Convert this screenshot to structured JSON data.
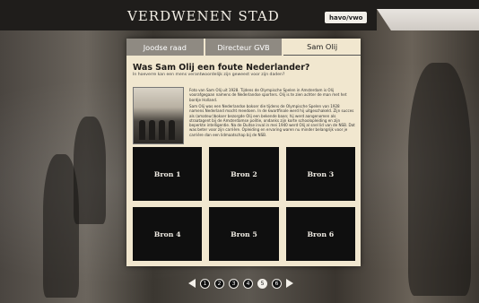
{
  "header": {
    "title": "VERDWENEN STAD",
    "level_button": "havo/vwo"
  },
  "panel": {
    "tabs": [
      {
        "label": "Joodse raad",
        "active": false
      },
      {
        "label": "Directeur GVB",
        "active": false
      },
      {
        "label": "Sam Olij",
        "active": true
      }
    ],
    "question_title": "Was Sam Olij een foute Nederlander?",
    "question_subtitle": "In hoeverre kan een mens verantwoordelijk zijn geweest voor zijn daden?",
    "paragraph1": "Foto van Sam Olij uit 1928. Tijdens de Olympische Spelen in Amsterdam is Olij voorafgegaan namens de Nederlandse sporters. Olij is te zien achter de man met het bordje Holland.",
    "paragraph2": "Sam Olij was een Nederlandse bokser die tijdens de Olympische Spelen van 1928 namens Nederland mocht meedoen. In de kwartfinale werd hij uitgeschakeld. Zijn succes als (amateur)bokser bezorgde Olij een bekende baan; hij werd aangenomen als straatagent bij de Amsterdamse politie, ondanks zijn korte schoolopleiding en zijn beperkte intelligentie. Na de Duitse inval in mei 1940 werd Olij al snel lid van de NSB. Dat was beter voor zijn carrière. Opleiding en ervaring waren nu minder belangrijk voor je carrière dan een lidmaatschap bij de NSB.",
    "sources": [
      "Bron 1",
      "Bron 2",
      "Bron 3",
      "Bron 4",
      "Bron 5",
      "Bron 6"
    ]
  },
  "pager": {
    "pages": [
      "1",
      "2",
      "3",
      "4",
      "5",
      "6"
    ],
    "current": "5"
  },
  "colors": {
    "panel_bg": "#f1e7cf",
    "tab_inactive": "#8f8a82",
    "source_tile": "#0f0f0f",
    "topbar": "#1f1d1b"
  }
}
